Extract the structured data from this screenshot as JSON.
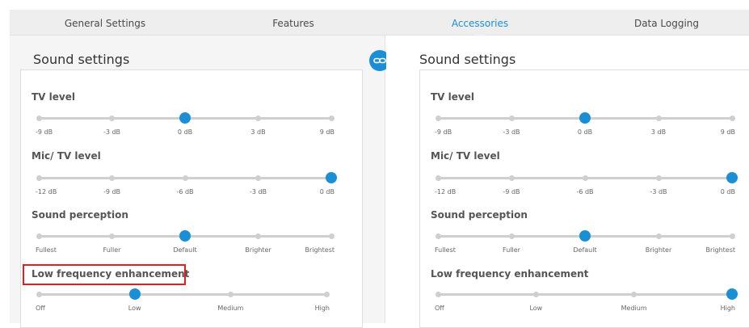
{
  "tabs": [
    {
      "label": "General Settings",
      "active": false
    },
    {
      "label": "Features",
      "active": false
    },
    {
      "label": "Accessories",
      "active": true
    },
    {
      "label": "Data Logging",
      "active": false
    }
  ],
  "link_button": {
    "icon": "link-icon"
  },
  "left": {
    "title": "Sound settings",
    "settings": [
      {
        "label": "TV level",
        "ticks": [
          "-9 dB",
          "-3 dB",
          "0 dB",
          "3 dB",
          "9 dB"
        ],
        "value": "0 dB"
      },
      {
        "label": "Mic/ TV level",
        "ticks": [
          "-12 dB",
          "-9 dB",
          "-6 dB",
          "-3 dB",
          "0 dB"
        ],
        "value": "0 dB"
      },
      {
        "label": "Sound perception",
        "ticks": [
          "Fullest",
          "Fuller",
          "Default",
          "Brighter",
          "Brightest"
        ],
        "value": "Default"
      },
      {
        "label": "Low frequency enhancement",
        "ticks": [
          "Off",
          "Low",
          "Medium",
          "High"
        ],
        "value": "Low"
      }
    ]
  },
  "right": {
    "title": "Sound settings",
    "settings": [
      {
        "label": "TV level",
        "ticks": [
          "-9 dB",
          "-3 dB",
          "0 dB",
          "3 dB",
          "9 dB"
        ],
        "value": "0 dB"
      },
      {
        "label": "Mic/ TV level",
        "ticks": [
          "-12 dB",
          "-9 dB",
          "-6 dB",
          "-3 dB",
          "0 dB"
        ],
        "value": "0 dB"
      },
      {
        "label": "Sound perception",
        "ticks": [
          "Fullest",
          "Fuller",
          "Default",
          "Brighter",
          "Brightest"
        ],
        "value": "Default"
      },
      {
        "label": "Low frequency enhancement",
        "ticks": [
          "Off",
          "Low",
          "Medium",
          "High"
        ],
        "value": "High"
      }
    ]
  },
  "colors": {
    "accent": "#1a8fd6",
    "highlight": "#e02020"
  }
}
